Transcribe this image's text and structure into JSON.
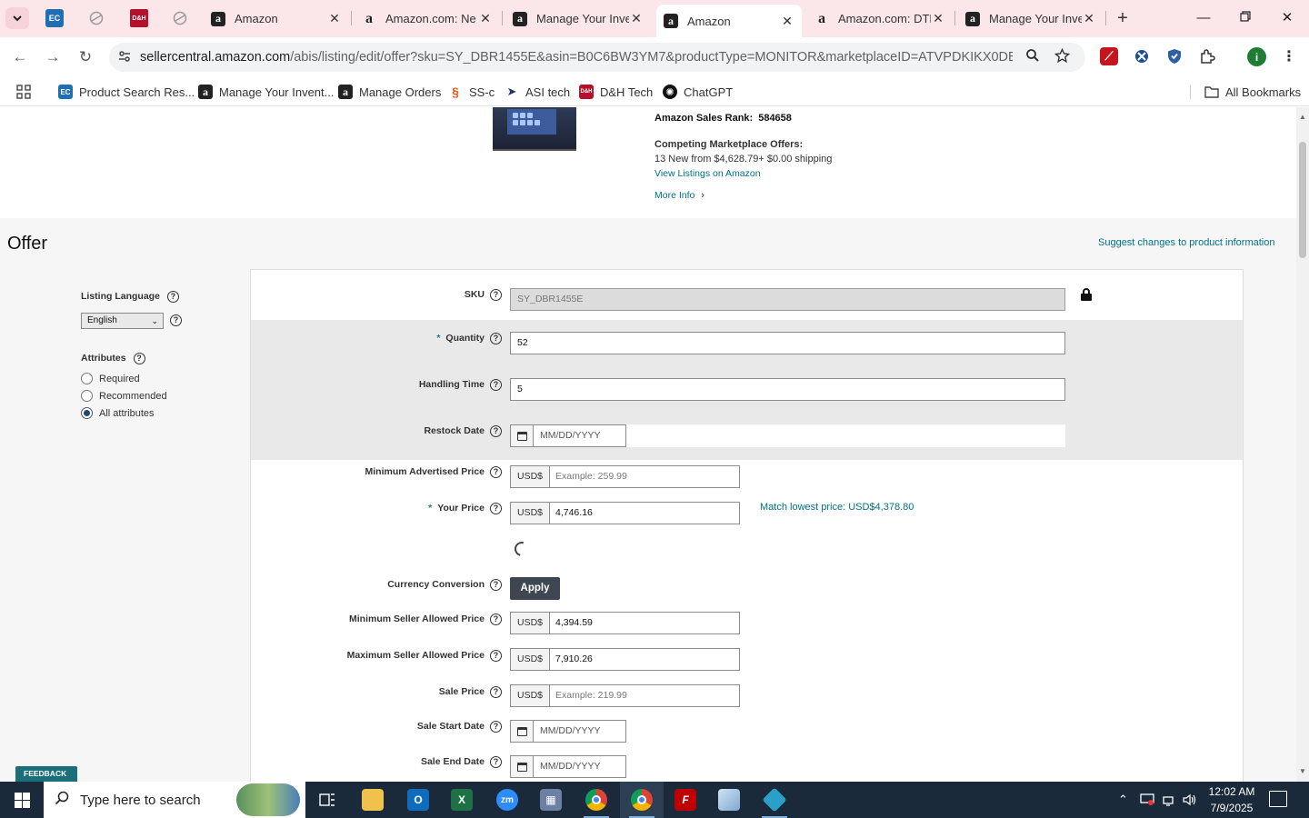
{
  "browser": {
    "tabs": [
      {
        "label": "Amazon"
      },
      {
        "label": "Amazon.com: Ne"
      },
      {
        "label": "Manage Your Inve"
      },
      {
        "label": "Amazon"
      },
      {
        "label": "Amazon.com: DTE"
      },
      {
        "label": "Manage Your Inve"
      }
    ],
    "url_host": "sellercentral.amazon.com",
    "url_rest": "/abis/listing/edit/offer?sku=SY_DBR1455E&asin=B0C6BW3YM7&productType=MONITOR&marketplaceID=ATVPDKIKX0DER&ref...",
    "bookmarks": [
      {
        "label": "Product Search Res..."
      },
      {
        "label": "Manage Your Invent..."
      },
      {
        "label": "Manage Orders"
      },
      {
        "label": "SS-c"
      },
      {
        "label": "ASI tech"
      },
      {
        "label": "D&H Tech"
      },
      {
        "label": "ChatGPT"
      }
    ],
    "all_bookmarks": "All Bookmarks",
    "profile_initial": "i"
  },
  "product": {
    "sales_rank_label": "Amazon Sales Rank:",
    "sales_rank_value": "584658",
    "competing_title": "Competing Marketplace Offers:",
    "competing_text": "13 New  from $4,628.79+ $0.00 shipping",
    "view_listings": "View Listings on Amazon",
    "more_info": "More Info"
  },
  "offer": {
    "title": "Offer",
    "suggest_link": "Suggest changes to product information",
    "listing_language_label": "Listing Language",
    "listing_language_value": "English",
    "attributes_label": "Attributes",
    "attribute_options": [
      "Required",
      "Recommended",
      "All attributes"
    ],
    "attribute_selected": "All attributes",
    "fields": {
      "sku_label": "SKU",
      "sku_value": "SY_DBR1455E",
      "quantity_label": "Quantity",
      "quantity_value": "52",
      "handling_label": "Handling Time",
      "handling_value": "5",
      "restock_label": "Restock Date",
      "date_placeholder": "MM/DD/YYYY",
      "map_label": "Minimum Advertised Price",
      "map_placeholder": "Example: 259.99",
      "your_price_label": "Your Price",
      "your_price_value": "4,746.16",
      "match_lowest": "Match lowest price: USD$4,378.80",
      "currency_conversion_label": "Currency Conversion",
      "apply_button": "Apply",
      "min_seller_label": "Minimum Seller Allowed Price",
      "min_seller_value": "4,394.59",
      "max_seller_label": "Maximum Seller Allowed Price",
      "max_seller_value": "7,910.26",
      "sale_price_label": "Sale Price",
      "sale_price_placeholder": "Example: 219.99",
      "sale_start_label": "Sale Start Date",
      "sale_end_label": "Sale End Date",
      "currency": "USD$",
      "required_mark": "*"
    },
    "feedback": "FEEDBACK"
  },
  "taskbar": {
    "search_placeholder": "Type here to search",
    "time": "12:02 AM",
    "date": "7/9/2025"
  },
  "colors": {
    "link": "#007185",
    "tabstrip": "#fbe7ea",
    "taskbar": "#1b2a3a",
    "apply_button": "#3d4651"
  }
}
